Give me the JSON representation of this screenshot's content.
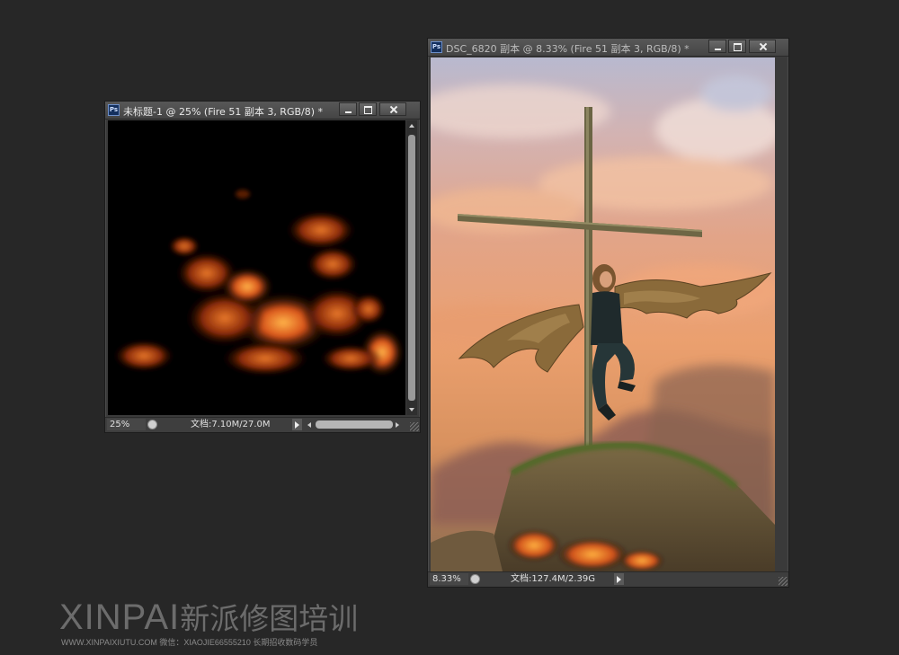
{
  "windows": {
    "left": {
      "title": "未标题-1 @ 25% (Fire 51 副本 3, RGB/8) *",
      "zoom": "25%",
      "doc_info": "文档:7.10M/27.0M"
    },
    "right": {
      "title": "DSC_6820 副本 @ 8.33% (Fire 51 副本 3, RGB/8) *",
      "zoom": "8.33%",
      "doc_info": "文档:127.4M/2.39G"
    }
  },
  "ps_icon_label": "Ps",
  "watermark": {
    "brand": "XINPAI",
    "brand_cn": "新派修图培训",
    "subline": "WWW.XINPAIXIUTU.COM  微信：XIAOJIE66555210 长期招收数码学员"
  },
  "colors": {
    "app_background": "#272727",
    "window_chrome": "#3b3b3b",
    "fire": "#e0621a"
  },
  "icons": [
    "photoshop-doc-icon",
    "minimize-icon",
    "maximize-icon",
    "close-icon",
    "status-icon",
    "play-arrow-icon",
    "resize-grip-icon"
  ]
}
